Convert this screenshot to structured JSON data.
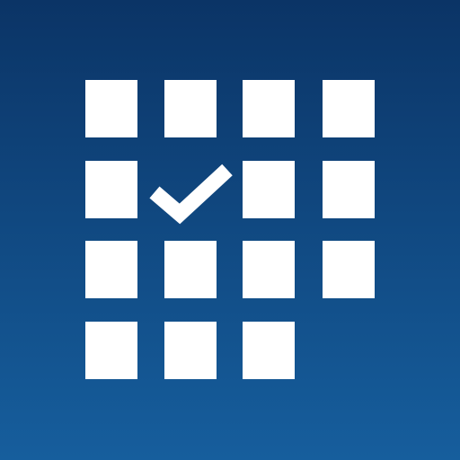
{
  "app_icon": {
    "name": "calendar-check",
    "icon": "calendar-grid-with-checkmark",
    "colors": {
      "background_top": "#0b3466",
      "background_bottom": "#165e9d",
      "foreground": "#ffffff"
    },
    "grid": {
      "rows": 4,
      "columns": 4,
      "filled_cells": 14,
      "checked_cell": {
        "row": 2,
        "column": 2
      },
      "empty_cells": [
        {
          "row": 4,
          "column": 4
        }
      ]
    }
  }
}
